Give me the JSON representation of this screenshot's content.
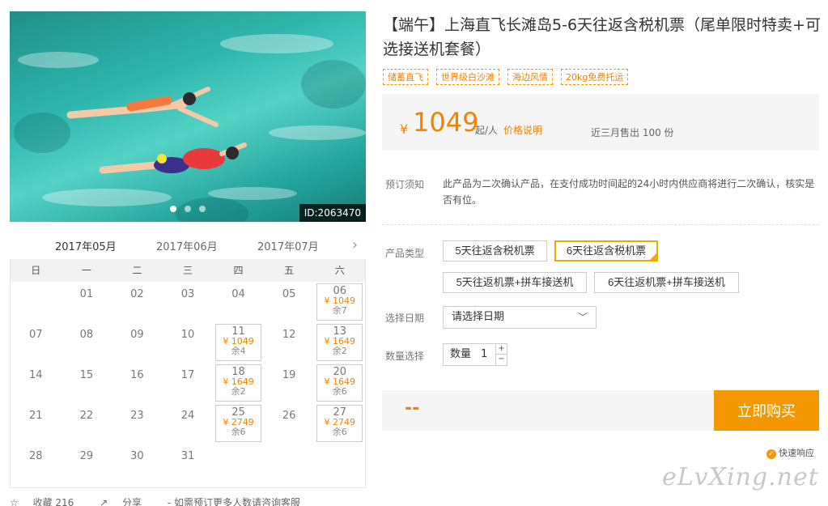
{
  "hero": {
    "photo_id": "ID:2063470"
  },
  "calendar": {
    "tabs": [
      "2017年05月",
      "2017年06月",
      "2017年07月"
    ],
    "weekdays": [
      "日",
      "一",
      "二",
      "三",
      "四",
      "五",
      "六"
    ],
    "rows": [
      [
        {
          "d": ""
        },
        {
          "d": "01"
        },
        {
          "d": "02"
        },
        {
          "d": "03"
        },
        {
          "d": "04"
        },
        {
          "d": "05"
        },
        {
          "d": "06",
          "p": "¥ 1049",
          "r": "余7"
        }
      ],
      [
        {
          "d": "07"
        },
        {
          "d": "08"
        },
        {
          "d": "09"
        },
        {
          "d": "10"
        },
        {
          "d": "11",
          "p": "¥ 1049",
          "r": "余4"
        },
        {
          "d": "12"
        },
        {
          "d": "13",
          "p": "¥ 1649",
          "r": "余2"
        }
      ],
      [
        {
          "d": "14"
        },
        {
          "d": "15"
        },
        {
          "d": "16"
        },
        {
          "d": "17"
        },
        {
          "d": "18",
          "p": "¥ 1649",
          "r": "余2"
        },
        {
          "d": "19"
        },
        {
          "d": "20",
          "p": "¥ 1649",
          "r": "余6"
        }
      ],
      [
        {
          "d": "21"
        },
        {
          "d": "22"
        },
        {
          "d": "23"
        },
        {
          "d": "24"
        },
        {
          "d": "25",
          "p": "¥ 2749",
          "r": "余6"
        },
        {
          "d": "26"
        },
        {
          "d": "27",
          "p": "¥ 2749",
          "r": "余6"
        }
      ],
      [
        {
          "d": "28"
        },
        {
          "d": "29"
        },
        {
          "d": "30"
        },
        {
          "d": "31"
        },
        {
          "d": ""
        },
        {
          "d": ""
        },
        {
          "d": ""
        }
      ]
    ]
  },
  "below_calendar": {
    "favorite": "收藏 216",
    "share": "分享",
    "note": "- 如需预订更多人数请咨询客服"
  },
  "product": {
    "title": "【端午】上海直飞长滩岛5-6天往返含税机票（尾单限时特卖+可选接送机套餐）",
    "tags": [
      "储蓄直飞",
      "世界级白沙滩",
      "海边风情",
      "20kg免费托运"
    ],
    "currency": "¥",
    "price": "1049",
    "per": "起/人",
    "price_explain": "价格说明",
    "sold": "近三月售出 100 份"
  },
  "booking": {
    "notice_label": "预订须知",
    "notice_text": "此产品为二次确认产品，在支付成功时间起的24小时内供应商将进行二次确认，核实是否有位。",
    "type_label": "产品类型",
    "types": [
      "5天往返含税机票",
      "6天往返含税机票",
      "5天往返机票+拼车接送机",
      "6天往返机票+拼车接送机"
    ],
    "date_label": "选择日期",
    "date_placeholder": "请选择日期",
    "qty_label": "数量选择",
    "qty_prefix": "数量",
    "qty_value": "1",
    "qty_up": "+",
    "qty_down": "−",
    "total": "--",
    "buy_label": "立即购买",
    "fast_response": "快速响应"
  },
  "watermark": "eLvXing.net",
  "colors": {
    "accent": "#f39800",
    "price": "#f08300",
    "panel": "#f5f5f5"
  }
}
